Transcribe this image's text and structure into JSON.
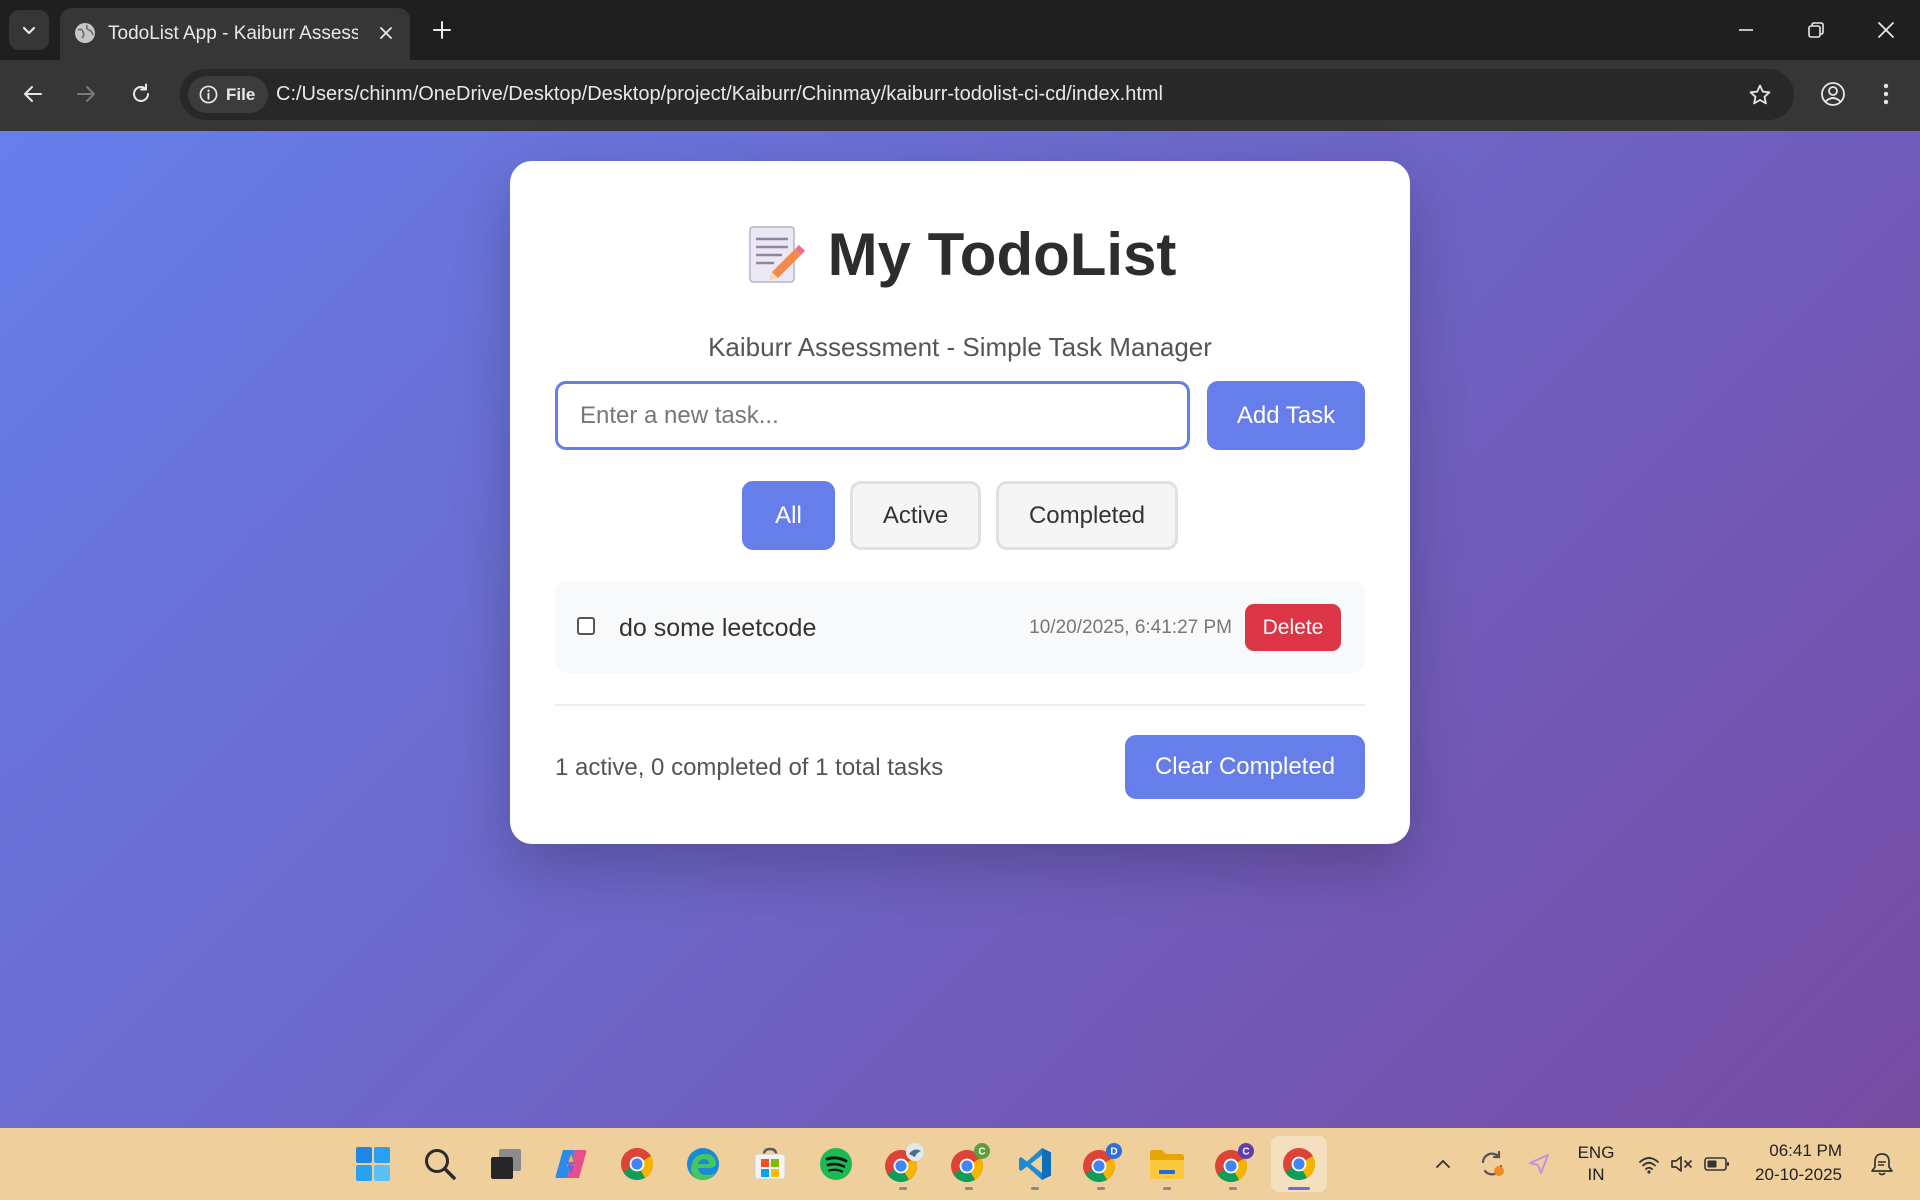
{
  "browser": {
    "tab_title": "TodoList App - Kaiburr Assessm",
    "address_chip": "File",
    "url": "C:/Users/chinm/OneDrive/Desktop/Desktop/project/Kaiburr/Chinmay/kaiburr-todolist-ci-cd/index.html"
  },
  "app": {
    "title": "My TodoList",
    "subtitle": "Kaiburr Assessment - Simple Task Manager",
    "input_placeholder": "Enter a new task...",
    "add_button": "Add Task",
    "filters": [
      {
        "label": "All",
        "active": true
      },
      {
        "label": "Active",
        "active": false
      },
      {
        "label": "Completed",
        "active": false
      }
    ],
    "todos": [
      {
        "text": "do some leetcode",
        "timestamp": "10/20/2025, 6:41:27 PM",
        "completed": false,
        "delete_label": "Delete"
      }
    ],
    "stats": "1 active, 0 completed of 1 total tasks",
    "clear_button": "Clear Completed",
    "colors": {
      "accent": "#667eea",
      "gradient_end": "#764ba2",
      "danger": "#dc3545"
    }
  },
  "taskbar": {
    "language": "ENG",
    "region": "IN",
    "time": "06:41 PM",
    "date": "20-10-2025",
    "apps": [
      "start-icon",
      "search-icon",
      "task-view-icon",
      "copilot-icon",
      "chrome-icon",
      "edge-icon",
      "store-icon",
      "spotify-icon",
      "chrome-profile-icon",
      "chrome-profile-c-icon",
      "vscode-icon",
      "chrome-profile-d-icon",
      "file-explorer-icon",
      "chrome-profile-c2-icon",
      "chrome-active-icon"
    ],
    "badges": {
      "chrome_profile_c": "C",
      "chrome_profile_d": "D",
      "chrome_profile_c2": "C"
    }
  }
}
